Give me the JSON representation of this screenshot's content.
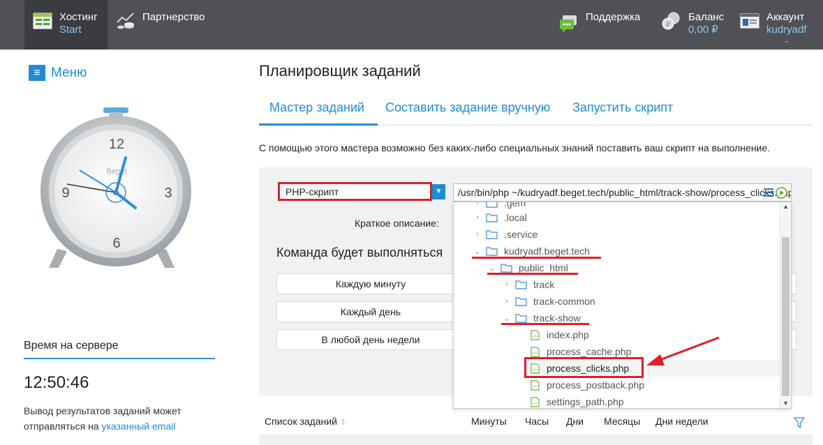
{
  "topnav": {
    "hosting_title": "Хостинг",
    "hosting_sub": "Start",
    "partnership": "Партнерство",
    "support": "Поддержка",
    "balance_title": "Баланс",
    "balance_value": "0,00 ₽",
    "account_title": "Аккаунт",
    "account_user": "kudryadf"
  },
  "sidebar": {
    "menu_label": "Меню",
    "server_time_title": "Время на сервере",
    "server_time_value": "12:50:46",
    "output_note_text": "Вывод результатов заданий может отправляться на ",
    "output_note_link": "указанный email",
    "clock_numbers": [
      "12",
      "3",
      "6",
      "9"
    ],
    "clock_brand": "Beget"
  },
  "main": {
    "title": "Планировщик заданий",
    "tabs": [
      {
        "label": "Мастер заданий"
      },
      {
        "label": "Составить задание вручную"
      },
      {
        "label": "Запустить скрипт"
      }
    ],
    "intro": "С помощью этого мастера возможно без каких-либо специальных знаний поставить ваш скрипт на выполнение.",
    "script_type": "PHP-скрипт",
    "command_value": "/usr/bin/php ~/kudryadf.beget.tech/public_html/track-show/process_clicks.php",
    "desc_label": "Краткое описание:",
    "cmd_heading": "Команда будет выполняться",
    "freq_buttons": [
      {
        "label": "Каждую минуту"
      },
      {
        "label": "Каждый день"
      },
      {
        "label": "В любой день недели"
      }
    ]
  },
  "tree": {
    "items": [
      {
        "label": ".gem",
        "type": "folder",
        "expanded": false
      },
      {
        "label": ".local",
        "type": "folder",
        "expanded": false
      },
      {
        "label": ".service",
        "type": "folder",
        "expanded": false
      },
      {
        "label": "kudryadf.beget.tech",
        "type": "folder",
        "expanded": true
      },
      {
        "label": "public_html",
        "type": "folder",
        "expanded": true
      },
      {
        "label": "track",
        "type": "folder",
        "expanded": false
      },
      {
        "label": "track-common",
        "type": "folder",
        "expanded": false
      },
      {
        "label": "track-show",
        "type": "folder",
        "expanded": true
      },
      {
        "label": "index.php",
        "type": "file"
      },
      {
        "label": "process_cache.php",
        "type": "file"
      },
      {
        "label": "process_clicks.php",
        "type": "file",
        "selected": true
      },
      {
        "label": "process_postback.php",
        "type": "file"
      },
      {
        "label": "settings_path.php",
        "type": "file"
      }
    ]
  },
  "tasks": {
    "list_label": "Список заданий",
    "columns": [
      "Минуты",
      "Часы",
      "Дни",
      "Месяцы",
      "Дни недели"
    ]
  },
  "colors": {
    "accent": "#1f8dd6",
    "topbar": "#4f5157",
    "annotation": "#e01e24"
  }
}
